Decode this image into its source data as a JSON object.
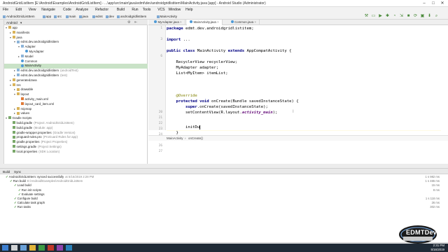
{
  "window": {
    "title": "AndroidGridListItem [E:\\Android\\Examples\\AndroidGridListItem] - ...\\app\\src\\main\\java\\edmt\\dev\\androidgridlistitem\\MainActivity.java [app] - Android Studio (Administrator)"
  },
  "menu": [
    "File",
    "Edit",
    "View",
    "Navigate",
    "Code",
    "Analyze",
    "Refactor",
    "Build",
    "Run",
    "Tools",
    "VCS",
    "Window",
    "Help"
  ],
  "breadcrumbs": [
    "AndroidGridListItem",
    "app",
    "src",
    "main",
    "java",
    "edmt",
    "dev",
    "androidgridlistitem",
    "MainActivity"
  ],
  "project_panel": {
    "view": "Android",
    "tree": [
      {
        "label": "app",
        "hint": "",
        "icon": "folder",
        "indent": 0,
        "open": true
      },
      {
        "label": "manifests",
        "hint": "",
        "icon": "folder",
        "indent": 1,
        "open": false
      },
      {
        "label": "java",
        "hint": "",
        "icon": "folder",
        "indent": 1,
        "open": true
      },
      {
        "label": "edmt.dev.androidgridlistitem",
        "hint": "",
        "icon": "package",
        "indent": 2,
        "open": true
      },
      {
        "label": "Adapter",
        "hint": "",
        "icon": "package",
        "indent": 3,
        "open": true
      },
      {
        "label": "MyAdapter",
        "hint": "",
        "icon": "class",
        "indent": 4,
        "open": null
      },
      {
        "label": "Model",
        "hint": "",
        "icon": "package",
        "indent": 3,
        "open": false
      },
      {
        "label": "Common",
        "hint": "",
        "icon": "class",
        "indent": 3,
        "open": null
      },
      {
        "label": "MainActivity",
        "hint": "",
        "icon": "class",
        "indent": 3,
        "open": null,
        "selected": true
      },
      {
        "label": "edmt.dev.androidgridlistitem",
        "hint": "(androidTest)",
        "icon": "package",
        "indent": 2,
        "open": false
      },
      {
        "label": "edmt.dev.androidgridlistitem",
        "hint": "(test)",
        "icon": "package",
        "indent": 2,
        "open": false
      },
      {
        "label": "generatedJava",
        "hint": "",
        "icon": "folder",
        "indent": 1,
        "open": false
      },
      {
        "label": "res",
        "hint": "",
        "icon": "folder",
        "indent": 1,
        "open": true
      },
      {
        "label": "drawable",
        "hint": "",
        "icon": "folder",
        "indent": 2,
        "open": false
      },
      {
        "label": "layout",
        "hint": "",
        "icon": "folder",
        "indent": 2,
        "open": true
      },
      {
        "label": "activity_main.xml",
        "hint": "",
        "icon": "xml",
        "indent": 3,
        "open": null
      },
      {
        "label": "layout_card_item.xml",
        "hint": "",
        "icon": "xml",
        "indent": 3,
        "open": null
      },
      {
        "label": "mipmap",
        "hint": "",
        "icon": "folder",
        "indent": 2,
        "open": false
      },
      {
        "label": "values",
        "hint": "",
        "icon": "folder",
        "indent": 2,
        "open": false
      },
      {
        "label": "Gradle Scripts",
        "hint": "",
        "icon": "gradle",
        "indent": 0,
        "open": true
      },
      {
        "label": "build.gradle",
        "hint": "(Project: AndroidGridListItem)",
        "icon": "gradle",
        "indent": 1,
        "open": null
      },
      {
        "label": "build.gradle",
        "hint": "(Module: app)",
        "icon": "gradle",
        "indent": 1,
        "open": null
      },
      {
        "label": "gradle-wrapper.properties",
        "hint": "(Gradle Version)",
        "icon": "gradle",
        "indent": 1,
        "open": null
      },
      {
        "label": "proguard-rules.pro",
        "hint": "(ProGuard Rules for app)",
        "icon": "gradle",
        "indent": 1,
        "open": null
      },
      {
        "label": "gradle.properties",
        "hint": "(Project Properties)",
        "icon": "gradle",
        "indent": 1,
        "open": null
      },
      {
        "label": "settings.gradle",
        "hint": "(Project Settings)",
        "icon": "gradle",
        "indent": 1,
        "open": null
      },
      {
        "label": "local.properties",
        "hint": "(SDK Location)",
        "icon": "gradle",
        "indent": 1,
        "open": null
      }
    ]
  },
  "editor": {
    "tabs": [
      {
        "label": "MyAdapter.java",
        "active": false
      },
      {
        "label": "MainActivity.java",
        "active": true
      },
      {
        "label": "Common.java",
        "active": false
      }
    ],
    "line_numbers": [
      "1",
      "",
      "3",
      "",
      "",
      "6",
      "",
      "",
      "",
      "",
      "",
      "",
      "",
      "",
      "",
      "20",
      "21",
      "22",
      "23",
      "24",
      "25",
      "26",
      "27",
      ""
    ],
    "footer_path": [
      "MainActivity",
      "onCreate()"
    ],
    "typed": "initDu"
  },
  "build": {
    "tabs": [
      "Build",
      "Sync"
    ],
    "rows": [
      {
        "text": "AndroidGridListItem: synced successfully",
        "time": "at 5/16/2019 2:28 PM",
        "indent": 0,
        "ok": true,
        "dur": "1 s 982 ms"
      },
      {
        "text": "Run build",
        "time": "E:\\Android\\Examples\\AndroidGridListItem",
        "indent": 1,
        "ok": true,
        "dur": "1 s 465 ms"
      },
      {
        "text": "Load build",
        "time": "",
        "indent": 2,
        "ok": true,
        "dur": "15 ms"
      },
      {
        "text": "Run init scripts",
        "time": "",
        "indent": 3,
        "ok": true,
        "dur": "8 ms"
      },
      {
        "text": "Evaluate settings",
        "time": "",
        "indent": 3,
        "ok": true,
        "dur": ""
      },
      {
        "text": "Configure build",
        "time": "",
        "indent": 2,
        "ok": true,
        "dur": "1 s 118 ms"
      },
      {
        "text": "Calculate task graph",
        "time": "",
        "indent": 2,
        "ok": true,
        "dur": "26 ms"
      },
      {
        "text": "Run tasks",
        "time": "",
        "indent": 2,
        "ok": true,
        "dur": "302 ms"
      }
    ]
  },
  "statusbar": {
    "message": "Cannot resolve symbol 'initDu'",
    "position": "25:15  CRLF  UTF-8  4 spaces"
  },
  "taskbar": {
    "time": "2:31 PM",
    "date": "5/16/2019"
  },
  "logo": {
    "text": "EDMTDev"
  },
  "colors": {
    "accent": "#3a8a2a",
    "selection": "#c9e2c7",
    "keyword": "#000080"
  }
}
